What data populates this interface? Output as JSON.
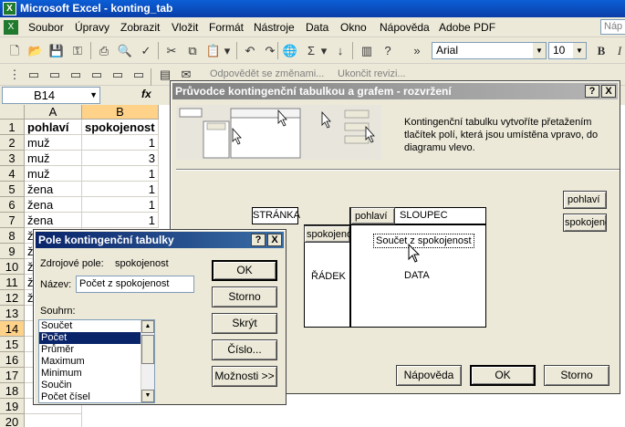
{
  "window": {
    "title": "Microsoft Excel - konting_tab"
  },
  "menu": {
    "items": [
      "Soubor",
      "Úpravy",
      "Zobrazit",
      "Vložit",
      "Formát",
      "Nástroje",
      "Data",
      "Okno",
      "Nápověda",
      "Adobe PDF"
    ],
    "help_placeholder": "Náp"
  },
  "toolbar": {
    "font_name": "Arial",
    "font_size": "10",
    "bold_label": "B",
    "italic_label": "I",
    "review_reply": "Odpovědět se změnami...",
    "review_end": "Ukončit revizi..."
  },
  "formula": {
    "cell_ref": "B14",
    "fx": "fx"
  },
  "sheet": {
    "columns": [
      "A",
      "B"
    ],
    "rows": [
      "1",
      "2",
      "3",
      "4",
      "5",
      "6",
      "7",
      "8",
      "9",
      "10",
      "11",
      "12",
      "13",
      "14",
      "15",
      "16",
      "17",
      "18",
      "19",
      "20"
    ],
    "header": [
      "pohlaví",
      "spokojenost"
    ],
    "data": [
      [
        "muž",
        "1"
      ],
      [
        "muž",
        "3"
      ],
      [
        "muž",
        "1"
      ],
      [
        "žena",
        "1"
      ],
      [
        "žena",
        "1"
      ],
      [
        "žena",
        "1"
      ],
      [
        "ž",
        ""
      ],
      [
        "ž",
        ""
      ],
      [
        "ž",
        ""
      ],
      [
        "ž",
        ""
      ],
      [
        "ž",
        ""
      ],
      [
        "",
        ""
      ]
    ]
  },
  "wizard": {
    "title": "Průvodce kontingenční tabulkou a grafem - rozvržení",
    "help_btn": "?",
    "close_btn": "X",
    "description": "Kontingenční tabulku vytvoříte přetažením tlačítek polí, která jsou umístěna vpravo, do diagramu vlevo.",
    "page_label": "STRÁNKA",
    "row_label": "ŘÁDEK",
    "data_label": "DATA",
    "column_field": "pohlaví",
    "column_label": "SLOUPEC",
    "row_field": "spokojenost",
    "data_field": "Součet z spokojenost",
    "fields": [
      "pohlaví",
      "spokojenost"
    ],
    "buttons": {
      "help": "Nápověda",
      "ok": "OK",
      "cancel": "Storno"
    }
  },
  "field_dialog": {
    "title": "Pole kontingenční tabulky",
    "help_btn": "?",
    "close_btn": "X",
    "source_label": "Zdrojové pole:",
    "source_value": "spokojenost",
    "name_label": "Název:",
    "name_value": "Počet z spokojenost",
    "summary_label": "Souhrn:",
    "summary_options": [
      "Součet",
      "Počet",
      "Průměr",
      "Maximum",
      "Minimum",
      "Součin",
      "Počet čísel"
    ],
    "selected_summary": "Počet",
    "buttons": {
      "ok": "OK",
      "cancel": "Storno",
      "hide": "Skrýt",
      "number": "Číslo...",
      "options": "Možnosti >>"
    }
  },
  "colors": {
    "title_blue": "#0a3ea8",
    "selection": "#ffd28a",
    "face": "#ece9d8"
  }
}
